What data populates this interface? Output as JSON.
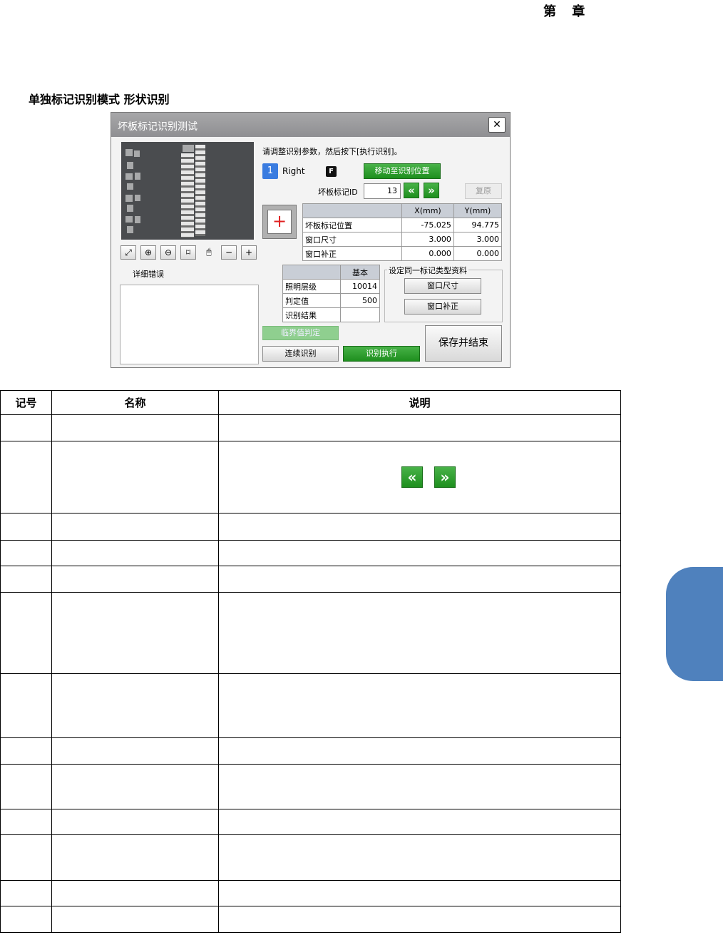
{
  "page": {
    "chapter": "第  章",
    "section_title": "单独标记识别模式 形状识别"
  },
  "dialog": {
    "title": "坏板标记识别测试",
    "close_icon": "close-icon",
    "instruction": "请调整识别参数，然后按下[执行识别]。",
    "camera_number": "1",
    "camera_side": "Right",
    "front_badge": "F",
    "move_button": "移动至识别位置",
    "mark_id_label": "坏板标记ID",
    "mark_id_value": "13",
    "prev_label": "«",
    "next_label": "»",
    "restore_button": "复原",
    "target_symbol": "+",
    "toolbar_icons": [
      "fit-image-icon",
      "zoom-in-icon",
      "zoom-out-icon",
      "frame-icon",
      "mouse-icon",
      "minus-icon",
      "plus-icon"
    ],
    "toolbar_glyphs": [
      "⤢",
      "⊕",
      "⊖",
      "⌑",
      "🖱",
      "−",
      "+"
    ],
    "error_label": "详细错误",
    "position_table": {
      "headers": [
        "",
        "X(mm)",
        "Y(mm)"
      ],
      "rows": [
        [
          "坏板标记位置",
          "-75.025",
          "94.775"
        ],
        [
          "窗口尺寸",
          "3.000",
          "3.000"
        ],
        [
          "窗口补正",
          "0.000",
          "0.000"
        ]
      ]
    },
    "param_table": {
      "headers": [
        "",
        "基本"
      ],
      "rows": [
        [
          "照明层级",
          "10014"
        ],
        [
          "判定值",
          "500"
        ],
        [
          "识别结果",
          ""
        ]
      ]
    },
    "mark_group_title": "设定同一标记类型资料",
    "window_size_button": "窗口尺寸",
    "window_comp_button": "窗口补正",
    "threshold_button": "临界值判定",
    "continuous_button": "连续识别",
    "execute_button": "识别执行",
    "save_button": "保存并结束",
    "accent_green": "#1e8f1e",
    "accent_blue": "#3a7ce0"
  },
  "legend": {
    "headers": [
      "记号",
      "名称",
      "说明"
    ],
    "arrow_icons": [
      "«",
      "»"
    ]
  }
}
